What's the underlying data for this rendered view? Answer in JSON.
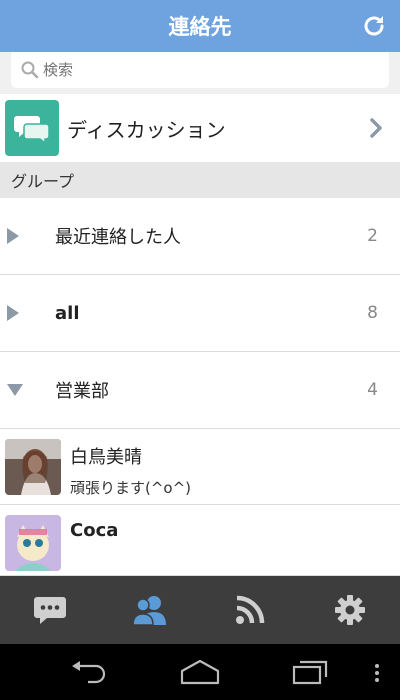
{
  "header": {
    "title": "連絡先",
    "refresh_icon": "refresh-icon"
  },
  "search": {
    "placeholder": "検索"
  },
  "discussion": {
    "label": "ディスカッション"
  },
  "groups_header": {
    "label": "グループ"
  },
  "groups": [
    {
      "name": "最近連絡した人",
      "count": "2",
      "expanded": false
    },
    {
      "name": "all",
      "count": "8",
      "expanded": false
    },
    {
      "name": "営業部",
      "count": "4",
      "expanded": true
    }
  ],
  "contacts": [
    {
      "name": "白鳥美晴",
      "status": "頑張ります(^o^)"
    },
    {
      "name": "Coca",
      "status": ""
    }
  ],
  "tabs": [
    {
      "icon": "chat-icon",
      "active": false
    },
    {
      "icon": "contacts-icon",
      "active": true
    },
    {
      "icon": "rss-icon",
      "active": false
    },
    {
      "icon": "settings-gear-icon",
      "active": false
    }
  ],
  "colors": {
    "header": "#6fa3df",
    "discussion_icon": "#3cb49c",
    "tab_active": "#5b9ad5",
    "tab_inactive": "#cfcfcf",
    "tabbar": "#3d3d3d"
  }
}
